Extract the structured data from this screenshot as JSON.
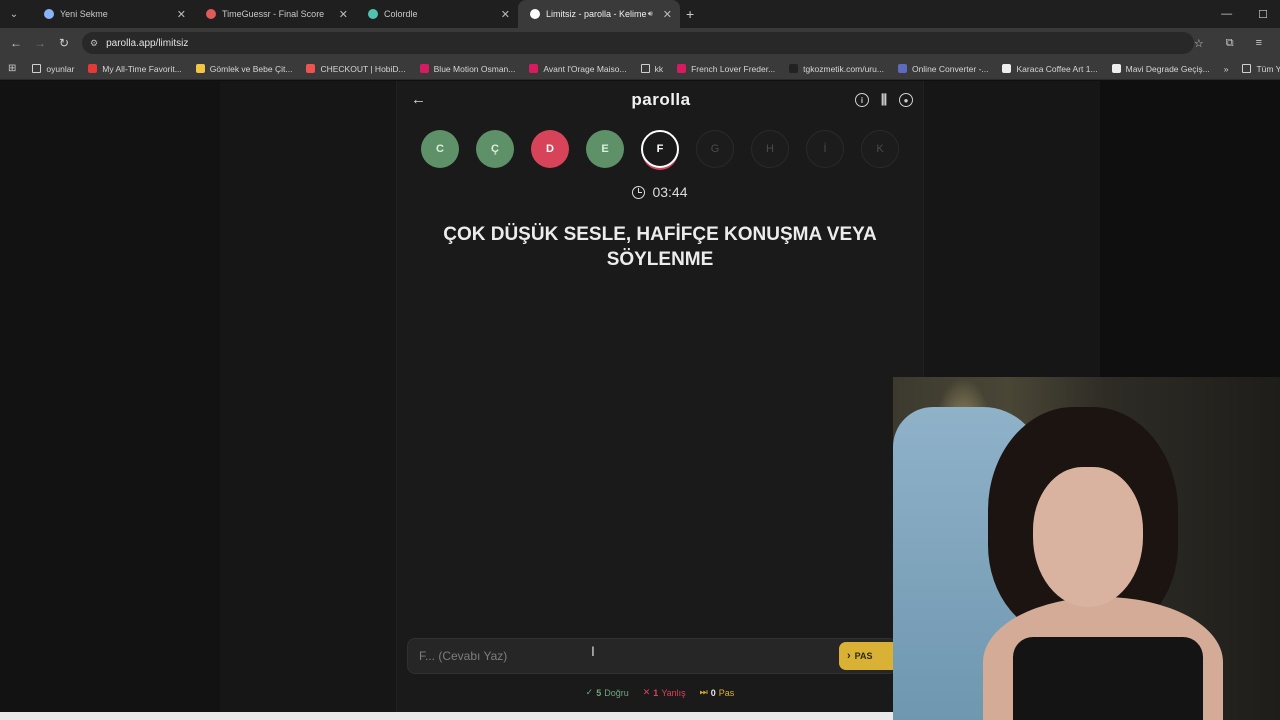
{
  "browser": {
    "tabs": [
      {
        "title": "Yeni Sekme",
        "favicon_color": "#8ab4f8",
        "active": false
      },
      {
        "title": "TimeGuessr - Final Score",
        "favicon_color": "#e05a5a",
        "active": false
      },
      {
        "title": "Colordle",
        "favicon_color": "#4fc3b0",
        "active": false
      },
      {
        "title": "Limitsiz - parolla - Kelime o",
        "favicon_color": "#ffffff",
        "active": true
      }
    ],
    "url": "parolla.app/limitsiz",
    "bookmarks": [
      {
        "label": "oyunlar",
        "type": "folder"
      },
      {
        "label": "My All-Time Favorit...",
        "color": "#e53935"
      },
      {
        "label": "Gömlek ve Bebe Çit...",
        "color": "#f4c542"
      },
      {
        "label": "CHECKOUT | HobiD...",
        "color": "#ef5350"
      },
      {
        "label": "Blue Motion Osman...",
        "color": "#d81b60"
      },
      {
        "label": "Avant l'Orage Maiso...",
        "color": "#d81b60"
      },
      {
        "label": "kk",
        "type": "folder"
      },
      {
        "label": "French Lover Freder...",
        "color": "#d81b60"
      },
      {
        "label": "tgkozmetik.com/uru...",
        "color": "#222222"
      },
      {
        "label": "Online Converter -...",
        "color": "#5c6bc0"
      },
      {
        "label": "Karaca Coffee Art 1...",
        "color": "#eeeeee"
      },
      {
        "label": "Mavi Degrade Geçiş...",
        "color": "#eeeeee"
      }
    ],
    "bookmarks_more": "Tüm Yer"
  },
  "game": {
    "brand": "parolla",
    "letters": [
      {
        "char": "C",
        "state": "correct"
      },
      {
        "char": "Ç",
        "state": "correct"
      },
      {
        "char": "D",
        "state": "wrong"
      },
      {
        "char": "E",
        "state": "correct"
      },
      {
        "char": "F",
        "state": "current"
      },
      {
        "char": "G",
        "state": "pending"
      },
      {
        "char": "H",
        "state": "pending"
      },
      {
        "char": "İ",
        "state": "pending"
      },
      {
        "char": "K",
        "state": "pending"
      }
    ],
    "timer": "03:44",
    "question": "ÇOK DÜŞÜK SESLE, HAFİFÇE KONUŞMA VEYA SÖYLENME",
    "answer_placeholder": "F... (Cevabı Yaz)",
    "pass_label": "PAS",
    "stats": {
      "correct_count": "5",
      "correct_label": "Doğru",
      "wrong_count": "1",
      "wrong_label": "Yanlış",
      "pass_count": "0",
      "pass_label": "Pas"
    }
  },
  "colors": {
    "correct": "#5e9168",
    "wrong": "#d7445a",
    "accent_yellow": "#d9b235"
  }
}
